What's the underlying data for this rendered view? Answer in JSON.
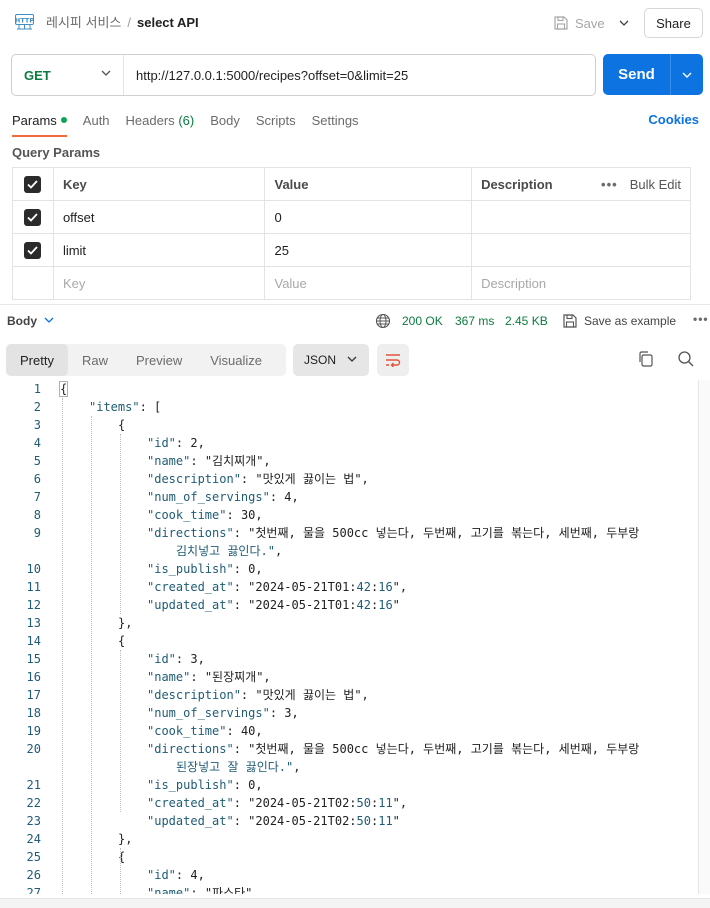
{
  "header": {
    "collection": "레시피 서비스",
    "separator": "/",
    "request_name": "select API",
    "save_label": "Save",
    "share_label": "Share"
  },
  "request": {
    "method": "GET",
    "url": "http://127.0.0.1:5000/recipes?offset=0&limit=25",
    "send_label": "Send"
  },
  "tabs": {
    "params": "Params",
    "auth": "Auth",
    "headers": "Headers",
    "headers_count": "(6)",
    "body": "Body",
    "scripts": "Scripts",
    "settings": "Settings",
    "cookies": "Cookies"
  },
  "query_params": {
    "title": "Query Params",
    "headers": {
      "key": "Key",
      "value": "Value",
      "description": "Description",
      "bulk_edit": "Bulk Edit",
      "more": "•••"
    },
    "rows": [
      {
        "key": "offset",
        "value": "0"
      },
      {
        "key": "limit",
        "value": "25"
      }
    ],
    "placeholder": {
      "key": "Key",
      "value": "Value",
      "description": "Description"
    }
  },
  "response": {
    "body_label": "Body",
    "status": "200 OK",
    "time": "367 ms",
    "size": "2.45 KB",
    "save_example": "Save as example",
    "more": "•••",
    "view_tabs": [
      "Pretty",
      "Raw",
      "Preview",
      "Visualize"
    ],
    "format": "JSON"
  },
  "code_lines": [
    {
      "n": "1",
      "i": 0,
      "t": "{"
    },
    {
      "n": "2",
      "i": 1,
      "t": "\"items\": ["
    },
    {
      "n": "3",
      "i": 2,
      "t": "{"
    },
    {
      "n": "4",
      "i": 3,
      "t": "\"id\": 2,"
    },
    {
      "n": "5",
      "i": 3,
      "t": "\"name\": \"김치찌개\","
    },
    {
      "n": "6",
      "i": 3,
      "t": "\"description\": \"맛있게 끓이는 법\","
    },
    {
      "n": "7",
      "i": 3,
      "t": "\"num_of_servings\": 4,"
    },
    {
      "n": "8",
      "i": 3,
      "t": "\"cook_time\": 30,"
    },
    {
      "n": "9",
      "i": 3,
      "t": "\"directions\": \"첫번째, 물을 500cc 넣는다, 두번째, 고기를 볶는다, 세번째, 두부랑"
    },
    {
      "n": "",
      "i": 4,
      "t": "김치넣고 끓인다.\","
    },
    {
      "n": "10",
      "i": 3,
      "t": "\"is_publish\": 0,"
    },
    {
      "n": "11",
      "i": 3,
      "t": "\"created_at\": \"2024-05-21T01:42:16\","
    },
    {
      "n": "12",
      "i": 3,
      "t": "\"updated_at\": \"2024-05-21T01:42:16\""
    },
    {
      "n": "13",
      "i": 2,
      "t": "},"
    },
    {
      "n": "14",
      "i": 2,
      "t": "{"
    },
    {
      "n": "15",
      "i": 3,
      "t": "\"id\": 3,"
    },
    {
      "n": "16",
      "i": 3,
      "t": "\"name\": \"된장찌개\","
    },
    {
      "n": "17",
      "i": 3,
      "t": "\"description\": \"맛있게 끓이는 법\","
    },
    {
      "n": "18",
      "i": 3,
      "t": "\"num_of_servings\": 3,"
    },
    {
      "n": "19",
      "i": 3,
      "t": "\"cook_time\": 40,"
    },
    {
      "n": "20",
      "i": 3,
      "t": "\"directions\": \"첫번째, 물을 500cc 넣는다, 두번째, 고기를 볶는다, 세번째, 두부랑"
    },
    {
      "n": "",
      "i": 4,
      "t": "된장넣고 잘 끓인다.\","
    },
    {
      "n": "21",
      "i": 3,
      "t": "\"is_publish\": 0,"
    },
    {
      "n": "22",
      "i": 3,
      "t": "\"created_at\": \"2024-05-21T02:50:11\","
    },
    {
      "n": "23",
      "i": 3,
      "t": "\"updated_at\": \"2024-05-21T02:50:11\""
    },
    {
      "n": "24",
      "i": 2,
      "t": "},"
    },
    {
      "n": "25",
      "i": 2,
      "t": "{"
    },
    {
      "n": "26",
      "i": 3,
      "t": "\"id\": 4,"
    },
    {
      "n": "27",
      "i": 3,
      "t": "\"name\": \"파스타\","
    }
  ]
}
